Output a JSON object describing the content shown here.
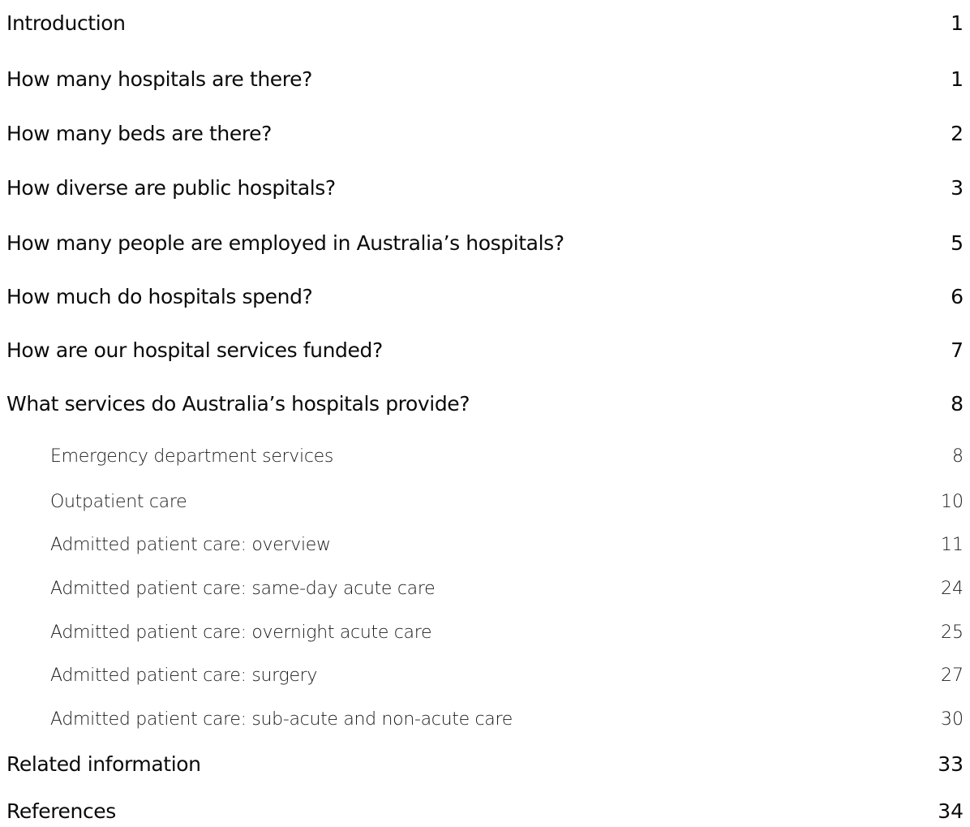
{
  "toc": {
    "entries": [
      {
        "title": "Introduction",
        "page": "1",
        "level": 1
      },
      {
        "title": "How many hospitals are there?",
        "page": "1",
        "level": 1
      },
      {
        "title": "How many beds are there?",
        "page": "2",
        "level": 1
      },
      {
        "title": "How diverse are public hospitals?",
        "page": "3",
        "level": 1
      },
      {
        "title": "How many people are employed in Australia’s hospitals?",
        "page": "5",
        "level": 1
      },
      {
        "title": "How much do hospitals spend?",
        "page": "6",
        "level": 1
      },
      {
        "title": "How are our hospital services funded?",
        "page": "7",
        "level": 1
      },
      {
        "title": "What services do Australia’s hospitals provide?",
        "page": "8",
        "level": 1
      },
      {
        "title": "Emergency department services",
        "page": "8",
        "level": 2
      },
      {
        "title": "Outpatient care",
        "page": "10",
        "level": 2
      },
      {
        "title": "Admitted patient care: overview",
        "page": "11",
        "level": 2
      },
      {
        "title": "Admitted patient care: same-day acute care",
        "page": "24",
        "level": 2
      },
      {
        "title": "Admitted patient care: overnight acute care",
        "page": "25",
        "level": 2
      },
      {
        "title": "Admitted patient care: surgery",
        "page": "27",
        "level": 2
      },
      {
        "title": "Admitted patient care: sub-acute and non-acute care",
        "page": "30",
        "level": 2
      },
      {
        "title": "Related information",
        "page": "33",
        "level": 1
      },
      {
        "title": "References",
        "page": "34",
        "level": 1
      }
    ]
  }
}
